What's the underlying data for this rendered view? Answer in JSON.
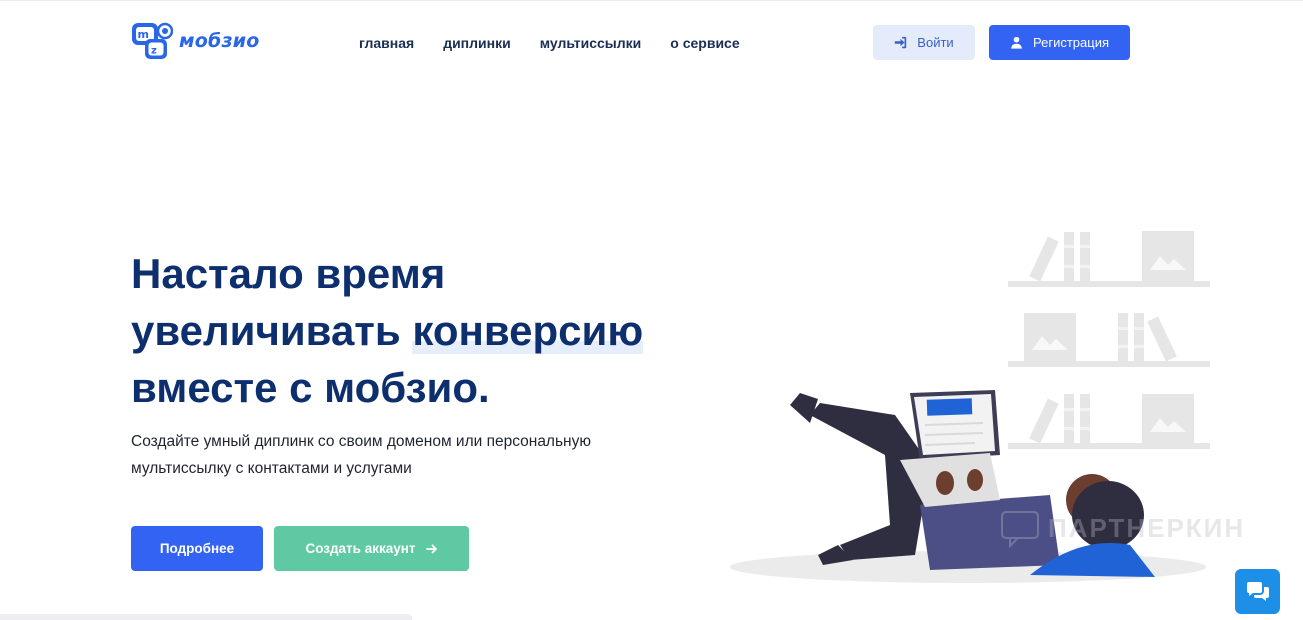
{
  "header": {
    "logo_text": "мобзио",
    "nav": [
      "главная",
      "диплинки",
      "мультиссылки",
      "о сервисе"
    ],
    "login_label": "Войти",
    "register_label": "Регистрация"
  },
  "hero": {
    "title_line1": "Настало время",
    "title_line2_a": "увеличивать ",
    "title_line2_b": "конверсию",
    "title_line3": "вместе с мобзио.",
    "subtitle": "Создайте умный диплинк со своим доменом или персональную мультиссылку с контактами и услугами",
    "more_button": "Подробнее",
    "create_button": "Создать аккаунт"
  },
  "watermark": "ПАРТНЕРКИН",
  "colors": {
    "primary": "#3263f3",
    "accent_green": "#5fc9a4",
    "title": "#0e2f6e",
    "chat": "#1e8fe6"
  },
  "icons": {
    "login": "sign-in-icon",
    "register": "user-icon",
    "create_arrow": "arrow-right-icon",
    "chat": "chat-bubbles-icon"
  }
}
